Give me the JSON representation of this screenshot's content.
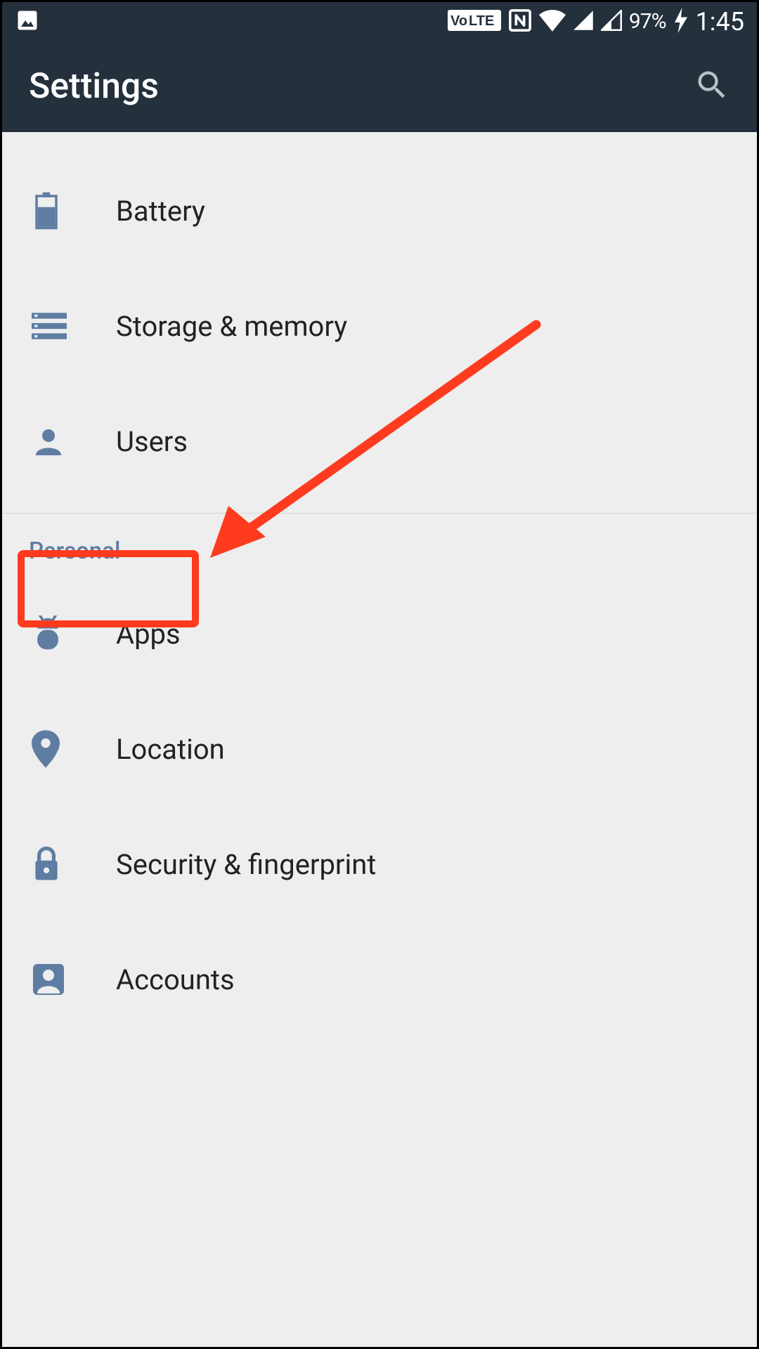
{
  "statusbar": {
    "volte_label": "LTE",
    "battery_percent": "97%",
    "time": "1:45"
  },
  "appbar": {
    "title": "Settings"
  },
  "list": {
    "top": [
      {
        "label": "Battery",
        "icon": "battery"
      },
      {
        "label": "Storage & memory",
        "icon": "storage"
      },
      {
        "label": "Users",
        "icon": "user"
      }
    ],
    "section_label": "Personal",
    "personal": [
      {
        "label": "Apps",
        "icon": "android"
      },
      {
        "label": "Location",
        "icon": "pin"
      },
      {
        "label": "Security & fingerprint",
        "icon": "lock"
      },
      {
        "label": "Accounts",
        "icon": "account"
      }
    ]
  },
  "annotation": {
    "target": "apps-row"
  }
}
